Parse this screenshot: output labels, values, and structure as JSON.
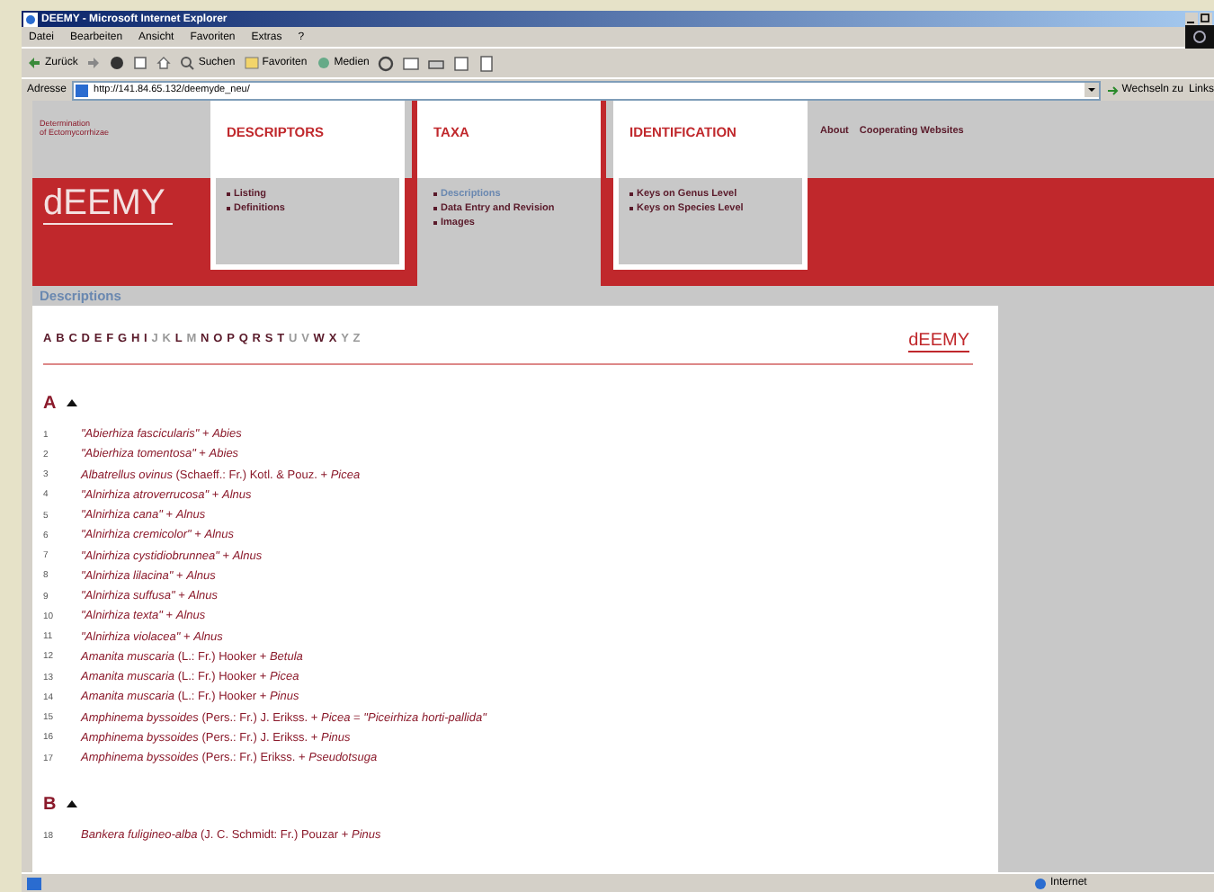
{
  "window": {
    "title": "DEEMY - Microsoft Internet Explorer"
  },
  "menu": [
    "Datei",
    "Bearbeiten",
    "Ansicht",
    "Favoriten",
    "Extras",
    "?"
  ],
  "toolbar": {
    "back": "Zurück",
    "search": "Suchen",
    "favorites": "Favoriten",
    "media": "Medien"
  },
  "address": {
    "label": "Adresse",
    "url": "http://141.84.65.132/deemyde_neu/",
    "go": "Wechseln zu",
    "links": "Links"
  },
  "site": {
    "tagline": [
      "Determination",
      "of Ectomycorrhizae"
    ],
    "logo": "dEEMY",
    "tabs": [
      {
        "title": "DESCRIPTORS",
        "selected": false,
        "items": [
          {
            "label": "Listing",
            "selected": false
          },
          {
            "label": "Definitions",
            "selected": false
          }
        ]
      },
      {
        "title": "TAXA",
        "selected": true,
        "items": [
          {
            "label": "Descriptions",
            "selected": true
          },
          {
            "label": "Data Entry and Revision",
            "selected": false
          },
          {
            "label": "Images",
            "selected": false
          }
        ]
      },
      {
        "title": "IDENTIFICATION",
        "selected": false,
        "items": [
          {
            "label": "Keys on Genus Level",
            "selected": false
          },
          {
            "label": "Keys on Species Level",
            "selected": false
          }
        ]
      }
    ],
    "links": [
      "About",
      "Cooperating Websites"
    ]
  },
  "page_title": "Descriptions",
  "alphabet": [
    {
      "letter": "A",
      "disabled": false
    },
    {
      "letter": "B",
      "disabled": false
    },
    {
      "letter": "C",
      "disabled": false
    },
    {
      "letter": "D",
      "disabled": false
    },
    {
      "letter": "E",
      "disabled": false
    },
    {
      "letter": "F",
      "disabled": false
    },
    {
      "letter": "G",
      "disabled": false
    },
    {
      "letter": "H",
      "disabled": false
    },
    {
      "letter": "I",
      "disabled": false
    },
    {
      "letter": "J",
      "disabled": true
    },
    {
      "letter": "K",
      "disabled": true
    },
    {
      "letter": "L",
      "disabled": false
    },
    {
      "letter": "M",
      "disabled": true
    },
    {
      "letter": "N",
      "disabled": false
    },
    {
      "letter": "O",
      "disabled": false
    },
    {
      "letter": "P",
      "disabled": false
    },
    {
      "letter": "Q",
      "disabled": false
    },
    {
      "letter": "R",
      "disabled": false
    },
    {
      "letter": "S",
      "disabled": false
    },
    {
      "letter": "T",
      "disabled": false
    },
    {
      "letter": "U",
      "disabled": true
    },
    {
      "letter": "V",
      "disabled": true
    },
    {
      "letter": "W",
      "disabled": false
    },
    {
      "letter": "X",
      "disabled": false
    },
    {
      "letter": "Y",
      "disabled": true
    },
    {
      "letter": "Z",
      "disabled": true
    }
  ],
  "small_logo": "dEEMY",
  "sections": [
    {
      "letter": "A",
      "entries": [
        {
          "number": "1",
          "text": "*\"Abierhiza fascicularis\"* + *Abies*"
        },
        {
          "number": "2",
          "text": "*\"Abierhiza tomentosa\"* + *Abies*"
        },
        {
          "number": "3",
          "text": "*Albatrellus ovinus* (Schaeff.: Fr.) Kotl. & Pouz. + *Picea*"
        },
        {
          "number": "4",
          "text": "*\"Alnirhiza atroverrucosa\"* + *Alnus*"
        },
        {
          "number": "5",
          "text": "*\"Alnirhiza cana\"* + *Alnus*"
        },
        {
          "number": "6",
          "text": "*\"Alnirhiza cremicolor\"* + *Alnus*"
        },
        {
          "number": "7",
          "text": "*\"Alnirhiza cystidiobrunnea\"* + *Alnus*"
        },
        {
          "number": "8",
          "text": "*\"Alnirhiza lilacina\"* + *Alnus*"
        },
        {
          "number": "9",
          "text": "*\"Alnirhiza suffusa\"* + *Alnus*"
        },
        {
          "number": "10",
          "text": "*\"Alnirhiza texta\"* + *Alnus*"
        },
        {
          "number": "11",
          "text": "*\"Alnirhiza violacea\"* + *Alnus*"
        },
        {
          "number": "12",
          "text": "*Amanita muscaria* (L.: Fr.) Hooker + *Betula*"
        },
        {
          "number": "13",
          "text": "*Amanita muscaria* (L.: Fr.) Hooker + *Picea*"
        },
        {
          "number": "14",
          "text": "*Amanita muscaria* (L.: Fr.) Hooker + *Pinus*"
        },
        {
          "number": "15",
          "text": "*Amphinema byssoides* (Pers.: Fr.) J. Erikss. + *Picea* = *\"Piceirhiza horti-pallida\"*"
        },
        {
          "number": "16",
          "text": "*Amphinema byssoides* (Pers.: Fr.) J. Erikss. + *Pinus*"
        },
        {
          "number": "17",
          "text": "*Amphinema byssoides* (Pers.: Fr.) Erikss. + *Pseudotsuga*"
        }
      ]
    },
    {
      "letter": "B",
      "entries": [
        {
          "number": "18",
          "text": "*Bankera fuligineo-alba* (J. C. Schmidt: Fr.) Pouzar + *Pinus*"
        }
      ]
    }
  ],
  "status_bar": {
    "zone": "Internet"
  }
}
